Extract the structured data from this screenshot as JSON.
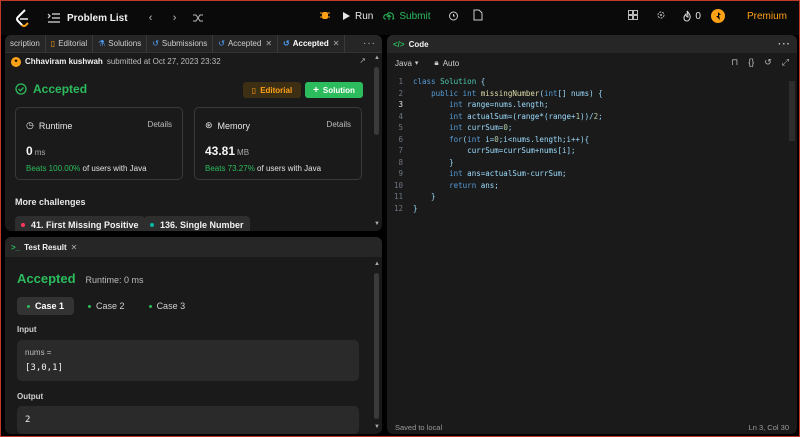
{
  "topbar": {
    "problem_list": "Problem List",
    "run_label": "Run",
    "submit_label": "Submit",
    "fire_count": "0",
    "premium_label": "Premium"
  },
  "left_tabs": [
    {
      "label": "scription"
    },
    {
      "label": "Editorial"
    },
    {
      "label": "Solutions"
    },
    {
      "label": "Submissions"
    },
    {
      "label": "Accepted"
    },
    {
      "label": "Accepted"
    }
  ],
  "submission": {
    "user": "Chhaviram kushwah",
    "submitted_text": "submitted at Oct 27, 2023 23:32",
    "status": "Accepted",
    "editorial_btn": "Editorial",
    "solution_btn": "Solution",
    "runtime": {
      "title": "Runtime",
      "details": "Details",
      "value": "0",
      "unit": "ms",
      "beats": "Beats 100.00%",
      "suffix": "of users with Java"
    },
    "memory": {
      "title": "Memory",
      "details": "Details",
      "value": "43.81",
      "unit": "MB",
      "beats": "Beats 73.27%",
      "suffix": "of users with Java"
    },
    "more_challenges": "More challenges",
    "challenges": [
      {
        "label": "41. First Missing Positive",
        "color": "#ff375f"
      },
      {
        "label": "136. Single Number",
        "color": "#00b8a3"
      }
    ]
  },
  "test_result": {
    "tab_label": "Test Result",
    "status": "Accepted",
    "runtime": "Runtime: 0 ms",
    "cases": [
      "Case 1",
      "Case 2",
      "Case 3"
    ],
    "input_label": "Input",
    "input_name": "nums =",
    "input_value": "[3,0,1]",
    "output_label": "Output",
    "output_value": "2"
  },
  "editor": {
    "tab_label": "Code",
    "language": "Java",
    "mode": "Auto",
    "lines": [
      "class Solution {",
      "    public int missingNumber(int[] nums) {",
      "        int range=nums.length;",
      "        int actualSum=(range*(range+1))/2;",
      "        int currSum=0;",
      "        for(int i=0;i<nums.length;i++){",
      "            currSum=currSum+nums[i];",
      "        }",
      "        int ans=actualSum-currSum;",
      "        return ans;",
      "    }",
      "}"
    ],
    "line_numbers": [
      "1",
      "2",
      "3",
      "4",
      "5",
      "6",
      "7",
      "8",
      "9",
      "10",
      "11",
      "12"
    ],
    "status_left": "Saved to local",
    "status_right": "Ln 3, Col 30"
  },
  "colors": {
    "accent": "#ffa116",
    "success": "#2cbb5d",
    "hard": "#ff375f",
    "easy": "#00b8a3"
  }
}
